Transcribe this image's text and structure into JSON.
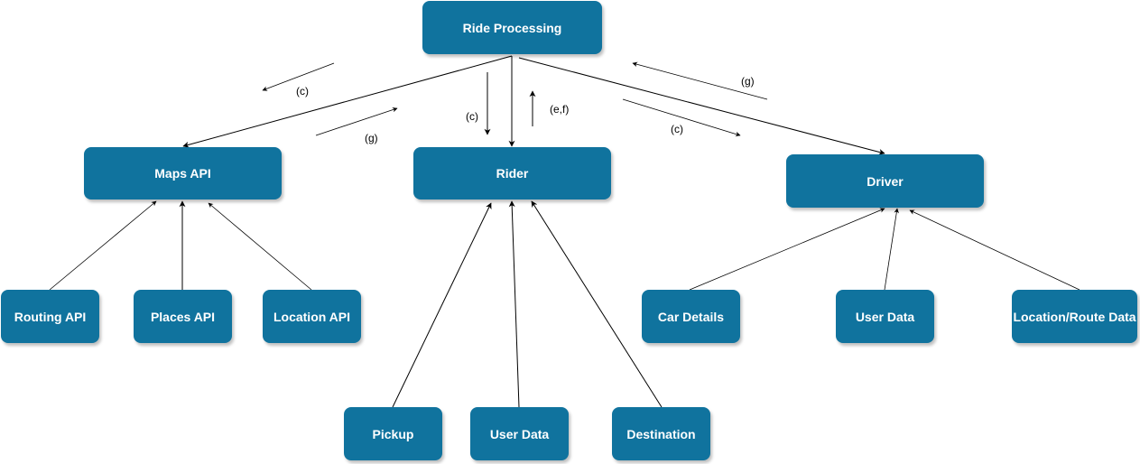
{
  "diagram": {
    "colors": {
      "node_fill": "#10739e",
      "node_text": "#ffffff",
      "edge": "#000000"
    },
    "nodes": {
      "ride_processing": "Ride Processing",
      "maps_api": "Maps API",
      "rider": "Rider",
      "driver": "Driver",
      "routing_api": "Routing API",
      "places_api": "Places API",
      "location_api": "Location API",
      "car_details": "Car Details",
      "driver_user_data": "User Data",
      "location_route_data": "Location/Route Data",
      "pickup": "Pickup",
      "rider_user_data": "User Data",
      "destination": "Destination"
    },
    "edges": [
      {
        "from": "ride_processing",
        "to": "maps_api"
      },
      {
        "from": "ride_processing",
        "to": "rider"
      },
      {
        "from": "ride_processing",
        "to": "driver"
      },
      {
        "from": "routing_api",
        "to": "maps_api"
      },
      {
        "from": "places_api",
        "to": "maps_api"
      },
      {
        "from": "location_api",
        "to": "maps_api"
      },
      {
        "from": "pickup",
        "to": "rider"
      },
      {
        "from": "rider_user_data",
        "to": "rider"
      },
      {
        "from": "destination",
        "to": "rider"
      },
      {
        "from": "car_details",
        "to": "driver"
      },
      {
        "from": "driver_user_data",
        "to": "driver"
      },
      {
        "from": "location_route_data",
        "to": "driver"
      }
    ],
    "flow_labels": {
      "maps_c": "(c)",
      "maps_g": "(g)",
      "rider_c": "(c)",
      "rider_ef": "(e,f)",
      "driver_g": "(g)",
      "driver_c": "(c)"
    }
  }
}
